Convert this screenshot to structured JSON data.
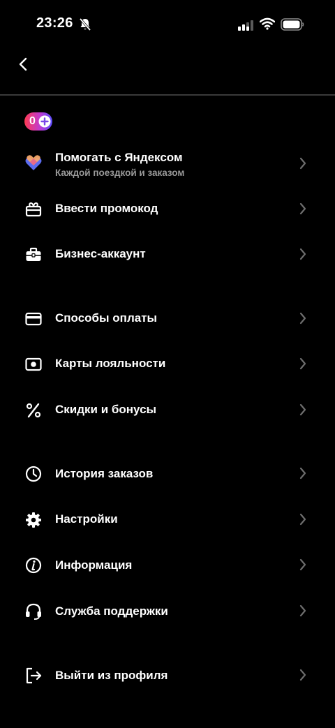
{
  "status_bar": {
    "time": "23:26"
  },
  "header": {
    "back_icon": "chevron-left-icon"
  },
  "plus_badge": {
    "count": "0",
    "icon": "plus-circle-icon",
    "gradient": [
      "#ff3a52",
      "#c13bd0",
      "#5a4dff"
    ]
  },
  "menu": [
    {
      "label": "Помогать с Яндексом",
      "sublabel": "Каждой поездкой и заказом",
      "icon": "hearts-icon"
    },
    {
      "label": "Ввести промокод",
      "icon": "gift-icon"
    },
    {
      "label": "Бизнес-аккаунт",
      "icon": "briefcase-icon"
    },
    {
      "label": "Способы оплаты",
      "icon": "card-icon"
    },
    {
      "label": "Карты лояльности",
      "icon": "loyalty-card-icon"
    },
    {
      "label": "Скидки и бонусы",
      "icon": "percent-icon"
    },
    {
      "label": "История заказов",
      "icon": "clock-icon"
    },
    {
      "label": "Настройки",
      "icon": "gear-icon"
    },
    {
      "label": "Информация",
      "icon": "info-icon"
    },
    {
      "label": "Служба поддержки",
      "icon": "headset-icon"
    },
    {
      "label": "Выйти из профиля",
      "icon": "logout-icon"
    }
  ],
  "colors": {
    "background": "#000000",
    "text": "#ffffff",
    "secondary_text": "#9a9a9a",
    "chevron": "#6e6e6e",
    "divider": "#3a3a3a"
  }
}
